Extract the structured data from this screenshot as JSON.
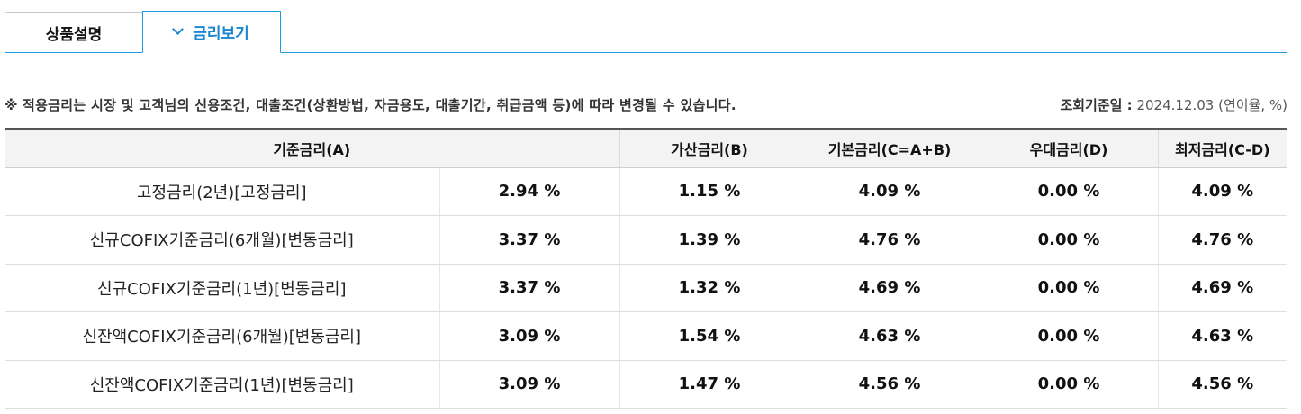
{
  "tabs": [
    {
      "label": "상품설명",
      "active": false
    },
    {
      "label": "금리보기",
      "active": true
    }
  ],
  "notice": {
    "prefix": "※",
    "text": "적용금리는 시장 및 고객님의 신용조건, 대출조건(상환방법, 자금용도, 대출기간, 취급금액 등)에 따라 변경될 수 있습니다."
  },
  "query": {
    "label": "조회기준일 :",
    "value": "2024.12.03 (연이율, %)"
  },
  "table": {
    "headers": [
      "기준금리(A)",
      "가산금리(B)",
      "기본금리(C=A+B)",
      "우대금리(D)",
      "최저금리(C-D)"
    ],
    "rows": [
      {
        "name": "고정금리(2년)[고정금리]",
        "base": "2.94 %",
        "add": "1.15 %",
        "basic": "4.09 %",
        "pref": "0.00 %",
        "min": "4.09 %"
      },
      {
        "name": "신규COFIX기준금리(6개월)[변동금리]",
        "base": "3.37 %",
        "add": "1.39 %",
        "basic": "4.76 %",
        "pref": "0.00 %",
        "min": "4.76 %"
      },
      {
        "name": "신규COFIX기준금리(1년)[변동금리]",
        "base": "3.37 %",
        "add": "1.32 %",
        "basic": "4.69 %",
        "pref": "0.00 %",
        "min": "4.69 %"
      },
      {
        "name": "신잔액COFIX기준금리(6개월)[변동금리]",
        "base": "3.09 %",
        "add": "1.54 %",
        "basic": "4.63 %",
        "pref": "0.00 %",
        "min": "4.63 %"
      },
      {
        "name": "신잔액COFIX기준금리(1년)[변동금리]",
        "base": "3.09 %",
        "add": "1.47 %",
        "basic": "4.56 %",
        "pref": "0.00 %",
        "min": "4.56 %"
      }
    ]
  },
  "colors": {
    "accent": "#1a9be0",
    "header_bg": "#f3f3f3"
  }
}
